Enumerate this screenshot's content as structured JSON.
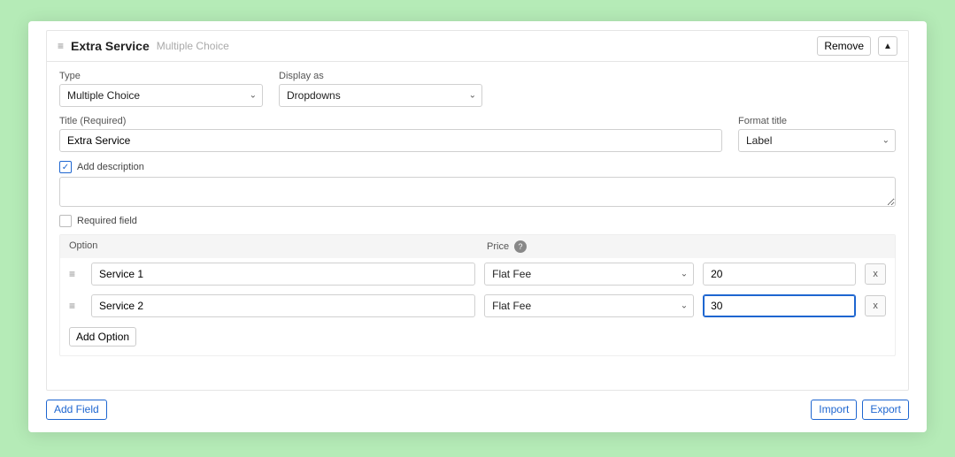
{
  "header": {
    "title": "Extra Service",
    "subtitle": "Multiple Choice",
    "remove_label": "Remove"
  },
  "type_field": {
    "label": "Type",
    "value": "Multiple Choice"
  },
  "display_field": {
    "label": "Display as",
    "value": "Dropdowns"
  },
  "title_field": {
    "label": "Title (Required)",
    "value": "Extra Service"
  },
  "format_field": {
    "label": "Format title",
    "value": "Label"
  },
  "add_desc_label": "Add description",
  "required_label": "Required field",
  "options_header": {
    "option": "Option",
    "price": "Price"
  },
  "options": [
    {
      "name": "Service 1",
      "price_type": "Flat Fee",
      "price": "20"
    },
    {
      "name": "Service 2",
      "price_type": "Flat Fee",
      "price": "30"
    }
  ],
  "add_option_label": "Add Option",
  "footer": {
    "add_field": "Add Field",
    "import": "Import",
    "export": "Export"
  }
}
